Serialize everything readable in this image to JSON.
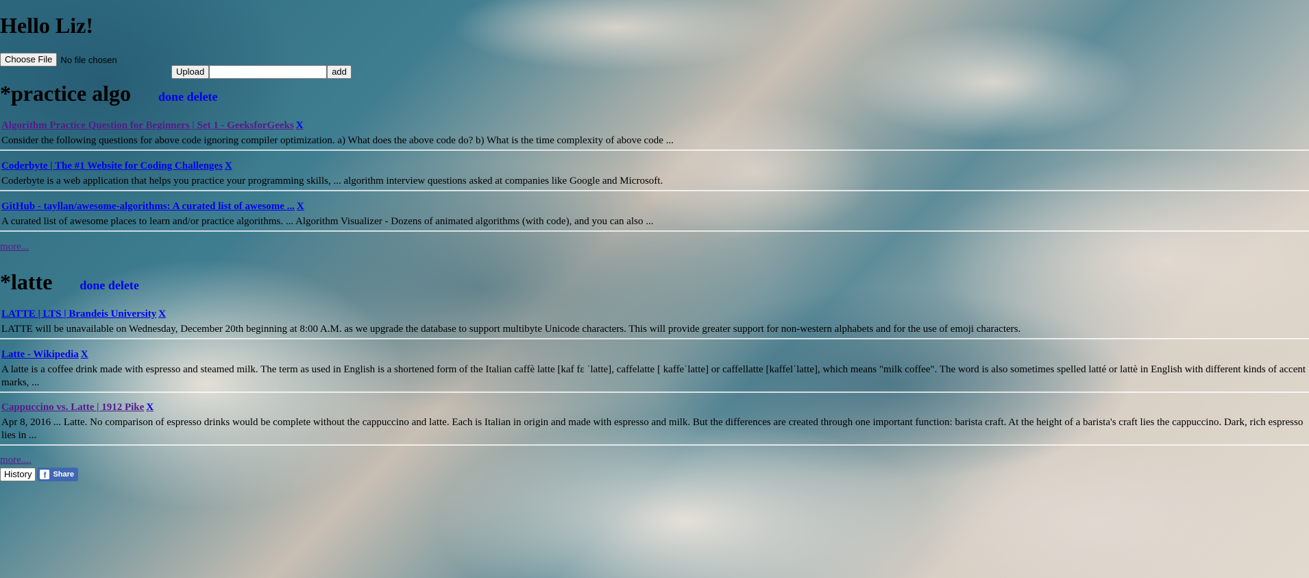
{
  "greeting": "Hello Liz!",
  "file_input": {
    "button_label": "Choose File",
    "status": "No file chosen"
  },
  "upload": {
    "upload_label": "Upload",
    "input_value": "",
    "add_label": "add"
  },
  "sections": [
    {
      "title": "*practice algo",
      "done_label": "done",
      "delete_label": "delete",
      "results": [
        {
          "title": "Algorithm Practice Question for Beginners | Set 1 - GeeksforGeeks",
          "remove": "X",
          "snippet": "Consider the following questions for above code ignoring compiler optimization. a) What does the above code do? b) What is the time complexity of above code ..."
        },
        {
          "title": "Coderbyte | The #1 Website for Coding Challenges",
          "remove": "X",
          "snippet": "Coderbyte is a web application that helps you practice your programming skills, ... algorithm interview questions asked at companies like Google and Microsoft."
        },
        {
          "title": "GitHub - tayllan/awesome-algorithms: A curated list of awesome ...",
          "remove": "X",
          "snippet": "A curated list of awesome places to learn and/or practice algorithms. ... Algorithm Visualizer - Dozens of animated algorithms (with code), and you can also ..."
        }
      ],
      "more_label": "more..."
    },
    {
      "title": "*latte",
      "done_label": "done",
      "delete_label": "delete",
      "results": [
        {
          "title": "LATTE | LTS | Brandeis University",
          "remove": "X",
          "snippet": "LATTE will be unavailable on Wednesday, December 20th beginning at 8:00 A.M. as we upgrade the database to support multibyte Unicode characters. This will provide greater support for non-western alphabets and for the use of emoji characters."
        },
        {
          "title": "Latte - Wikipedia",
          "remove": "X",
          "snippet": "A latte is a coffee drink made with espresso and steamed milk. The term as used in English is a shortened form of the Italian caffè latte [kaf fɛ ˈlatte], caffelatte [ kaffeˈlatte] or caffellatte [kaffelˈlatte], which means \"milk coffee\". The word is also sometimes spelled latté or lattè in English with different kinds of accent marks, ..."
        },
        {
          "title": "Cappuccino vs. Latte | 1912 Pike",
          "remove": "X",
          "snippet": "Apr 8, 2016 ... Latte. No comparison of espresso drinks would be complete without the cappuccino and latte. Each is Italian in origin and made with espresso and milk. But the differences are created through one important function: barista craft. At the height of a barista's craft lies the cappuccino. Dark, rich espresso lies in ..."
        }
      ],
      "more_label": "more...."
    }
  ],
  "footer": {
    "history_label": "History",
    "share_label": "Share",
    "share_icon": "facebook-icon"
  },
  "colors": {
    "link": "#0000ee",
    "visited_link": "#551a8b",
    "facebook": "#4267b2"
  }
}
